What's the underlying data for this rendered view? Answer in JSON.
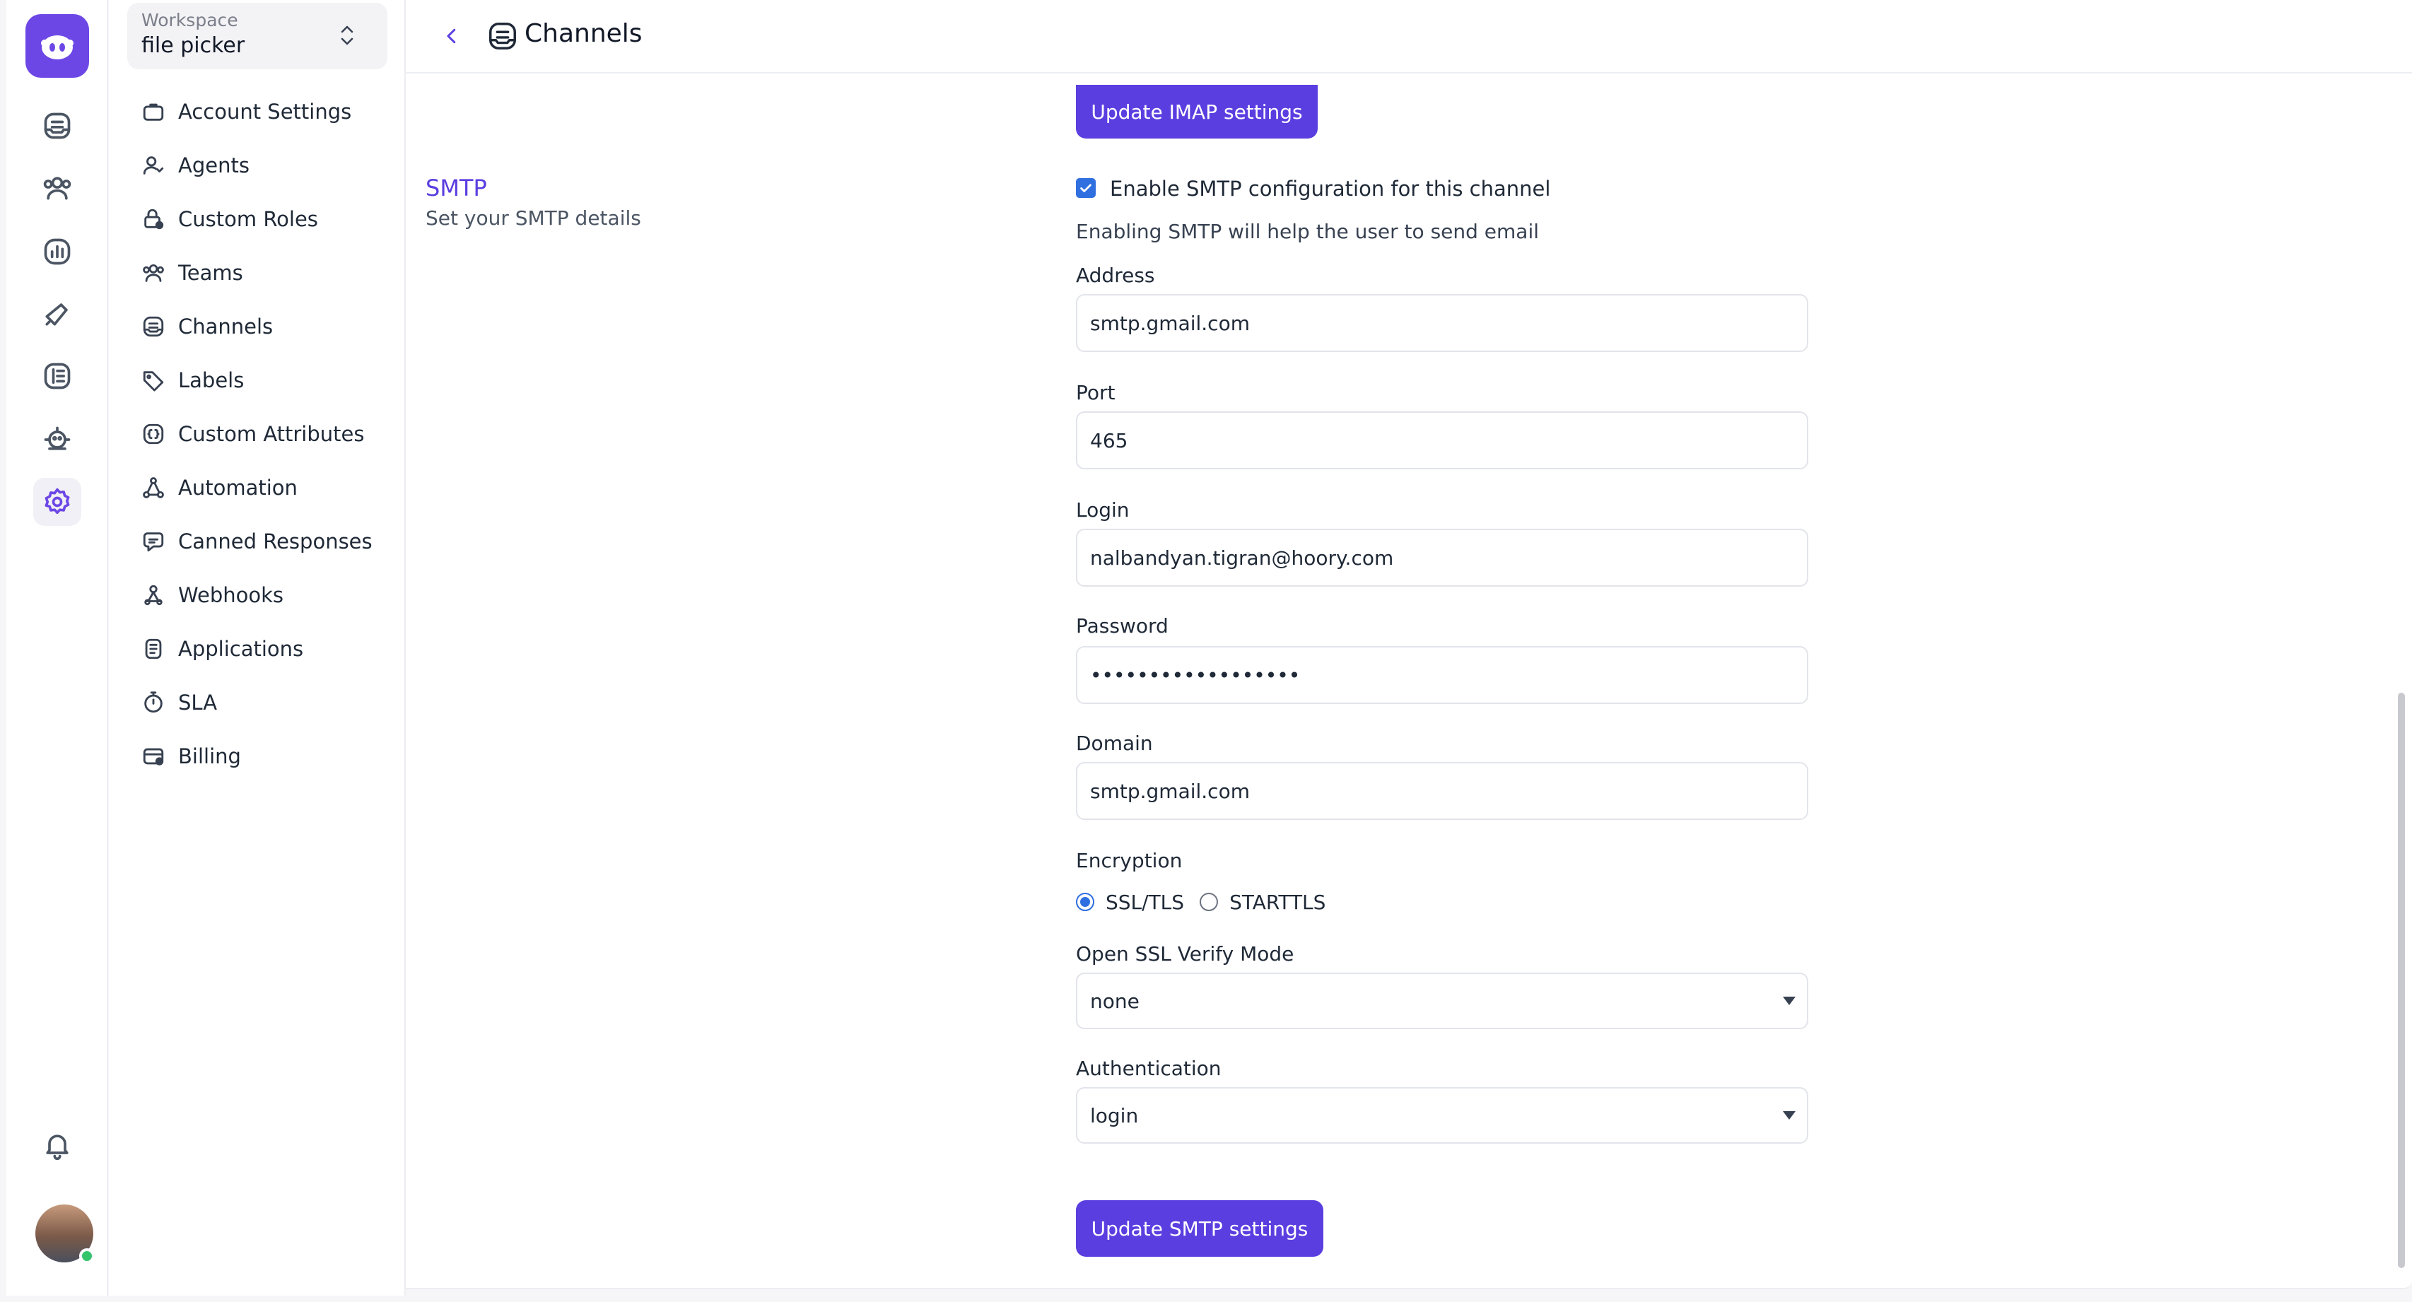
{
  "rail": {
    "items": [
      "inbox",
      "contacts",
      "reports",
      "campaigns",
      "library",
      "captain",
      "settings"
    ],
    "active": "settings"
  },
  "workspace": {
    "caption": "Workspace",
    "name": "file picker"
  },
  "sidebar": {
    "items": [
      {
        "label": "Account Settings",
        "icon": "briefcase-icon"
      },
      {
        "label": "Agents",
        "icon": "user-icon"
      },
      {
        "label": "Custom Roles",
        "icon": "lock-icon"
      },
      {
        "label": "Teams",
        "icon": "users-icon"
      },
      {
        "label": "Channels",
        "icon": "inbox-icon"
      },
      {
        "label": "Labels",
        "icon": "tag-icon"
      },
      {
        "label": "Custom Attributes",
        "icon": "brackets-icon"
      },
      {
        "label": "Automation",
        "icon": "workflow-icon"
      },
      {
        "label": "Canned Responses",
        "icon": "chat-bubble-icon"
      },
      {
        "label": "Webhooks",
        "icon": "webhook-icon"
      },
      {
        "label": "Applications",
        "icon": "app-icon"
      },
      {
        "label": "SLA",
        "icon": "timer-icon"
      },
      {
        "label": "Billing",
        "icon": "credit-card-icon"
      }
    ]
  },
  "header": {
    "title": "Channels"
  },
  "imap": {
    "update_label": "Update IMAP settings"
  },
  "smtp": {
    "section_title": "SMTP",
    "section_desc": "Set your SMTP details",
    "enable_label": "Enable SMTP configuration for this channel",
    "enabled": true,
    "help_text": "Enabling SMTP will help the user to send email",
    "address_label": "Address",
    "address_value": "smtp.gmail.com",
    "port_label": "Port",
    "port_value": "465",
    "login_label": "Login",
    "login_value": "nalbandyan.tigran@hoory.com",
    "password_label": "Password",
    "password_value": "••••••••••••••••••",
    "domain_label": "Domain",
    "domain_value": "smtp.gmail.com",
    "encryption_label": "Encryption",
    "encryption_options": [
      "SSL/TLS",
      "STARTTLS"
    ],
    "encryption_selected": "SSL/TLS",
    "ssl_verify_label": "Open SSL Verify Mode",
    "ssl_verify_value": "none",
    "auth_label": "Authentication",
    "auth_value": "login",
    "update_label": "Update SMTP settings"
  },
  "colors": {
    "accent": "#5b3ee0",
    "brand": "#6d47e6",
    "checkbox": "#2f6fe0",
    "online": "#33c46c"
  }
}
